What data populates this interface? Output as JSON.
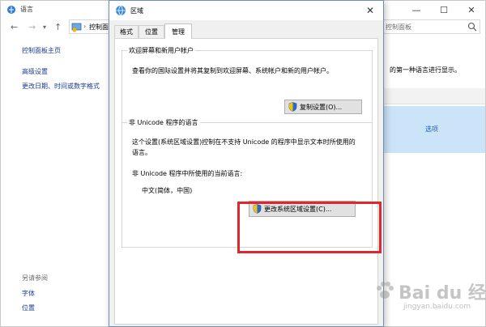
{
  "background_window": {
    "title": "语言",
    "address_text": "控制面",
    "search_placeholder": "控制面板",
    "sidebar": {
      "home": "控制面板主页",
      "advanced": "高级设置",
      "date_format": "更改日期、时间或数字格式",
      "see_also": "另请参阅",
      "fonts": "字体",
      "location": "位置"
    },
    "description_fragment": "的第一种语言进行显示。",
    "options_link": "选项",
    "accent_color": "#cce4f7"
  },
  "dialog": {
    "title": "区域",
    "tabs": [
      {
        "label": "格式",
        "selected": false
      },
      {
        "label": "位置",
        "selected": false
      },
      {
        "label": "管理",
        "selected": true
      }
    ],
    "welcome_group": {
      "legend": "欢迎屏幕和新用户帐户",
      "description": "查看你的国际设置并将其复制到欢迎屏幕、系统帐户和新的用户帐户。",
      "button_label": "复制设置(O)..."
    },
    "unicode_group": {
      "legend": "非 Unicode 程序的语言",
      "description": "这个设置(系统区域设置)控制在不支持 Unicode 的程序中显示文本时所使用的语言。",
      "current_label": "非 Unicode 程序中所使用的当前语言:",
      "current_value": "中文(简体，中国)",
      "button_label": "更改系统区域设置(C)..."
    }
  },
  "annotation": {
    "highlight_color": "#e0262f"
  },
  "watermark": {
    "brand": "Bai du 经验",
    "url": "jingyan.baidu.com"
  }
}
